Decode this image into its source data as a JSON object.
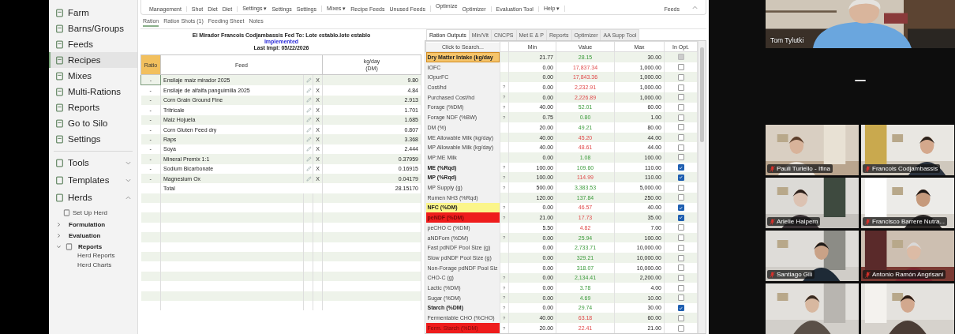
{
  "toolbar": {
    "groups": [
      {
        "buttons": [
          {
            "label": "Management",
            "kind": "low"
          }
        ]
      },
      {
        "buttons": [
          {
            "label": "Shot",
            "kind": "low"
          },
          {
            "label": "Diet",
            "kind": "low"
          },
          {
            "label": "Diet",
            "kind": "low"
          }
        ]
      },
      {
        "buttons": [
          {
            "label": "Settings ▾",
            "kind": "low"
          },
          {
            "label": "Settings",
            "kind": "low"
          },
          {
            "label": "Settings",
            "kind": "low"
          }
        ]
      },
      {
        "buttons": [
          {
            "label": "Mixes ▾",
            "kind": "low"
          },
          {
            "label": "Recipe Feeds",
            "kind": "low"
          },
          {
            "label": "Unused Feeds",
            "kind": "low"
          }
        ]
      },
      {
        "buttons": [
          {
            "label": "Optimize",
            "kind": "high"
          },
          {
            "label": "Optimizer",
            "kind": "low"
          }
        ]
      },
      {
        "buttons": [
          {
            "label": "Evaluation Tool",
            "kind": "low"
          }
        ]
      },
      {
        "buttons": [
          {
            "label": "Help ▾",
            "kind": "low"
          }
        ]
      },
      {
        "buttons": [
          {
            "label": "Feeds",
            "kind": "low"
          }
        ]
      }
    ]
  },
  "sidebar": {
    "items": [
      {
        "label": "Farm",
        "selected": false
      },
      {
        "label": "Barns/Groups",
        "selected": false
      },
      {
        "label": "Feeds",
        "selected": false
      },
      {
        "label": "Recipes",
        "selected": true
      },
      {
        "label": "Mixes",
        "selected": false
      },
      {
        "label": "Multi-Rations",
        "selected": false
      },
      {
        "label": "Reports",
        "selected": false
      },
      {
        "label": "Go to Silo",
        "selected": false
      },
      {
        "label": "Settings",
        "selected": false
      }
    ],
    "sections": [
      {
        "label": "Tools",
        "expanded": false
      },
      {
        "label": "Templates",
        "expanded": false
      },
      {
        "label": "Herds",
        "expanded": true,
        "children": [
          {
            "label": "Set Up Herd"
          },
          {
            "label": "Formulation",
            "expanded": false
          },
          {
            "label": "Evaluation",
            "expanded": false
          },
          {
            "label": "Reports",
            "expanded": true,
            "children": [
              {
                "label": "Herd Reports"
              },
              {
                "label": "Herd Charts"
              }
            ]
          }
        ]
      }
    ]
  },
  "subtabs": [
    {
      "label": "Ration",
      "selected": true
    },
    {
      "label": "Ration Shots (1)",
      "selected": false
    },
    {
      "label": "Feeding Sheet",
      "selected": false
    },
    {
      "label": "Notes",
      "selected": false
    }
  ],
  "ration": {
    "title": "El Mirador Francois Codjambassis  Fed To:  Lote establo.lote establo",
    "status": "Implemented",
    "last_impl": "Last Impl:  05/22/2026",
    "columns": [
      "Ratio",
      "Feed",
      "kg/day",
      "(DM)"
    ],
    "rows": [
      {
        "ratio": "-",
        "feed": "Ensilaje maiz mirador 2025",
        "delete": "X",
        "kg": "9.80"
      },
      {
        "ratio": "-",
        "feed": "Ensilaje de alfalfa panguimilla 2025",
        "delete": "X",
        "kg": "4.84"
      },
      {
        "ratio": "-",
        "feed": "Corn Grain Ground Fine",
        "delete": "X",
        "kg": "2.913"
      },
      {
        "ratio": "-",
        "feed": "Tritricale",
        "delete": "X",
        "kg": "1.701"
      },
      {
        "ratio": "-",
        "feed": "Maiz Hojuela",
        "delete": "X",
        "kg": "1.685"
      },
      {
        "ratio": "-",
        "feed": "Corn Gluten Feed dry",
        "delete": "X",
        "kg": "0.807"
      },
      {
        "ratio": "-",
        "feed": "Raps",
        "delete": "X",
        "kg": "3.368"
      },
      {
        "ratio": "-",
        "feed": "Soya",
        "delete": "X",
        "kg": "2.444"
      },
      {
        "ratio": "-",
        "feed": "Mineral Premix 1:1",
        "delete": "X",
        "kg": "0.37959"
      },
      {
        "ratio": "-",
        "feed": "Sodium Bicarbonate",
        "delete": "X",
        "kg": "0.16915"
      },
      {
        "ratio": "-",
        "feed": "Magnesium Ox",
        "delete": "X",
        "kg": "0.04179"
      }
    ],
    "total": {
      "label": "Total",
      "kg": "28.15170"
    }
  },
  "outputs": {
    "tabs": [
      {
        "label": "Ration Outputs",
        "selected": true
      },
      {
        "label": "Min/Vit",
        "selected": false
      },
      {
        "label": "CNCPS",
        "selected": false
      },
      {
        "label": "Met E & P",
        "selected": false
      },
      {
        "label": "Reports",
        "selected": false
      },
      {
        "label": "Optimizer",
        "selected": false
      },
      {
        "label": "AA Supp Tool",
        "selected": false
      }
    ],
    "search": {
      "placeholder": "Click to Search..."
    },
    "columns": [
      "Min",
      "Value",
      "Max",
      "In Opt."
    ],
    "rows": [
      {
        "name": "Dry Matter Intake (kg/day",
        "min": "21.77",
        "value": "28.15",
        "out_of_range": false,
        "max": "30.00",
        "in_opt": false,
        "disabled": true,
        "bold": true,
        "selected": true,
        "warning": false,
        "alert": false
      },
      {
        "name": "IOFC",
        "min": "0.00",
        "value": "17,837.34",
        "out_of_range": true,
        "max": "1,000.00",
        "in_opt": false,
        "disabled": false,
        "bold": false,
        "selected": false,
        "warning": false,
        "alert": false
      },
      {
        "name": "IOpurFC",
        "min": "0.00",
        "value": "17,843.36",
        "out_of_range": true,
        "max": "1,000.00",
        "in_opt": false,
        "disabled": false,
        "bold": false,
        "selected": false,
        "warning": false,
        "alert": false
      },
      {
        "name": "Cost/hd",
        "help": "?",
        "min": "0.00",
        "value": "2,232.91",
        "out_of_range": true,
        "max": "1,000.00",
        "in_opt": false,
        "disabled": false,
        "bold": false,
        "selected": false,
        "warning": false,
        "alert": false
      },
      {
        "name": "Purchased Cost/hd",
        "help": "?",
        "min": "0.00",
        "value": "2,226.89",
        "out_of_range": true,
        "max": "1,000.00",
        "in_opt": false,
        "disabled": false,
        "bold": false,
        "selected": false,
        "warning": false,
        "alert": false
      },
      {
        "name": "Forage (%DM)",
        "help": "?",
        "min": "40.00",
        "value": "52.01",
        "out_of_range": false,
        "max": "60.00",
        "in_opt": false,
        "disabled": false,
        "bold": false,
        "selected": false,
        "warning": false,
        "alert": false
      },
      {
        "name": "Forage NDF (%BW)",
        "help": "?",
        "min": "0.75",
        "value": "0.80",
        "out_of_range": false,
        "max": "1.00",
        "in_opt": false,
        "disabled": false,
        "bold": false,
        "selected": false,
        "warning": false,
        "alert": false
      },
      {
        "name": "DM (%)",
        "min": "20.00",
        "value": "49.21",
        "out_of_range": false,
        "max": "80.00",
        "in_opt": false,
        "disabled": false,
        "bold": false,
        "selected": false,
        "warning": false,
        "alert": false
      },
      {
        "name": "ME Allowable Milk (kg/day)",
        "min": "40.00",
        "value": "45.20",
        "out_of_range": true,
        "max": "44.00",
        "in_opt": false,
        "disabled": false,
        "bold": false,
        "selected": false,
        "warning": false,
        "alert": false
      },
      {
        "name": "MP Allowable Milk (kg/day)",
        "min": "40.00",
        "value": "48.61",
        "out_of_range": true,
        "max": "44.00",
        "in_opt": false,
        "disabled": false,
        "bold": false,
        "selected": false,
        "warning": false,
        "alert": false
      },
      {
        "name": "MP:ME Milk",
        "min": "0.00",
        "value": "1.08",
        "out_of_range": false,
        "max": "100.00",
        "in_opt": false,
        "disabled": false,
        "bold": false,
        "selected": false,
        "warning": false,
        "alert": false
      },
      {
        "name": "ME (%Rqd)",
        "help": "?",
        "min": "100.00",
        "value": "109.60",
        "out_of_range": false,
        "max": "110.00",
        "in_opt": true,
        "disabled": false,
        "bold": true,
        "selected": false,
        "warning": false,
        "alert": false
      },
      {
        "name": "MP (%Rqd)",
        "help": "?",
        "min": "100.00",
        "value": "114.99",
        "out_of_range": true,
        "max": "110.00",
        "in_opt": true,
        "disabled": false,
        "bold": true,
        "selected": false,
        "warning": false,
        "alert": false
      },
      {
        "name": "MP Supply (g)",
        "help": "?",
        "min": "500.00",
        "value": "3,383.53",
        "out_of_range": false,
        "max": "5,000.00",
        "in_opt": false,
        "disabled": false,
        "bold": false,
        "selected": false,
        "warning": false,
        "alert": false
      },
      {
        "name": "Rumen NH3 (%Rqd)",
        "min": "120.00",
        "value": "137.84",
        "out_of_range": false,
        "max": "250.00",
        "in_opt": false,
        "disabled": false,
        "bold": false,
        "selected": false,
        "warning": false,
        "alert": false
      },
      {
        "name": "NFC (%DM)",
        "help": "?",
        "min": "0.00",
        "value": "46.57",
        "out_of_range": true,
        "max": "40.00",
        "in_opt": true,
        "disabled": false,
        "bold": true,
        "selected": false,
        "warning": true,
        "alert": false
      },
      {
        "name": "peNDF (%DM)",
        "help": "?",
        "min": "21.00",
        "value": "17.73",
        "out_of_range": true,
        "max": "35.00",
        "in_opt": true,
        "disabled": false,
        "bold": true,
        "selected": false,
        "warning": false,
        "alert": true
      },
      {
        "name": "peCHO C (%DM)",
        "min": "5.50",
        "value": "4.82",
        "out_of_range": true,
        "max": "7.00",
        "in_opt": false,
        "disabled": false,
        "bold": false,
        "selected": false,
        "warning": false,
        "alert": false
      },
      {
        "name": "aNDFom (%DM)",
        "help": "?",
        "min": "0.00",
        "value": "25.94",
        "out_of_range": false,
        "max": "100.00",
        "in_opt": false,
        "disabled": false,
        "bold": false,
        "selected": false,
        "warning": false,
        "alert": false
      },
      {
        "name": "Fast pdNDF Pool Size (g)",
        "min": "0.00",
        "value": "2,733.71",
        "out_of_range": false,
        "max": "10,000.00",
        "in_opt": false,
        "disabled": false,
        "bold": false,
        "selected": false,
        "warning": false,
        "alert": false
      },
      {
        "name": "Slow pdNDF Pool Size (g)",
        "min": "0.00",
        "value": "329.21",
        "out_of_range": false,
        "max": "10,000.00",
        "in_opt": false,
        "disabled": false,
        "bold": false,
        "selected": false,
        "warning": false,
        "alert": false
      },
      {
        "name": "Non-Forage pdNDF Pool Siz",
        "min": "0.00",
        "value": "318.07",
        "out_of_range": false,
        "max": "10,000.00",
        "in_opt": false,
        "disabled": false,
        "bold": false,
        "selected": false,
        "warning": false,
        "alert": false
      },
      {
        "name": "CHO-C (g)",
        "help": "?",
        "min": "0.00",
        "value": "2,134.41",
        "out_of_range": false,
        "max": "2,200.00",
        "in_opt": false,
        "disabled": false,
        "bold": false,
        "selected": false,
        "warning": false,
        "alert": false
      },
      {
        "name": "Lactic (%DM)",
        "help": "?",
        "min": "0.00",
        "value": "3.78",
        "out_of_range": false,
        "max": "4.00",
        "in_opt": false,
        "disabled": false,
        "bold": false,
        "selected": false,
        "warning": false,
        "alert": false
      },
      {
        "name": "Sugar (%DM)",
        "help": "?",
        "min": "0.00",
        "value": "4.69",
        "out_of_range": false,
        "max": "10.00",
        "in_opt": false,
        "disabled": false,
        "bold": false,
        "selected": false,
        "warning": false,
        "alert": false
      },
      {
        "name": "Starch (%DM)",
        "help": "?",
        "min": "0.00",
        "value": "29.74",
        "out_of_range": false,
        "max": "30.00",
        "in_opt": true,
        "disabled": false,
        "bold": true,
        "selected": false,
        "warning": false,
        "alert": false
      },
      {
        "name": "Fermentable CHO (%CHO)",
        "help": "?",
        "min": "40.00",
        "value": "63.18",
        "out_of_range": true,
        "max": "60.00",
        "in_opt": false,
        "disabled": false,
        "bold": false,
        "selected": false,
        "warning": false,
        "alert": false
      },
      {
        "name": "Ferm. Starch (%DM)",
        "help": "?",
        "min": "20.00",
        "value": "22.41",
        "out_of_range": true,
        "max": "21.00",
        "in_opt": false,
        "disabled": false,
        "bold": false,
        "selected": false,
        "warning": false,
        "alert": true
      }
    ]
  },
  "call": {
    "speaker": {
      "name": "Tom Tylutki"
    },
    "tiles": [
      {
        "kind": "camera",
        "name": "Pauli Turiello - Ifina",
        "muted": true
      },
      {
        "kind": "camera",
        "name": "Francois Codjambassis",
        "muted": true
      },
      {
        "kind": "camera",
        "name": "Arielle Halpern",
        "muted": true
      },
      {
        "kind": "camera",
        "name": "Francisco Barrere Nutra...",
        "muted": true
      },
      {
        "kind": "camera",
        "name": "Santiago Gili",
        "muted": true
      },
      {
        "kind": "camera",
        "name": "Antonio Ramón Angrisani",
        "muted": true
      },
      {
        "kind": "picture"
      },
      {
        "kind": "picture"
      }
    ]
  }
}
